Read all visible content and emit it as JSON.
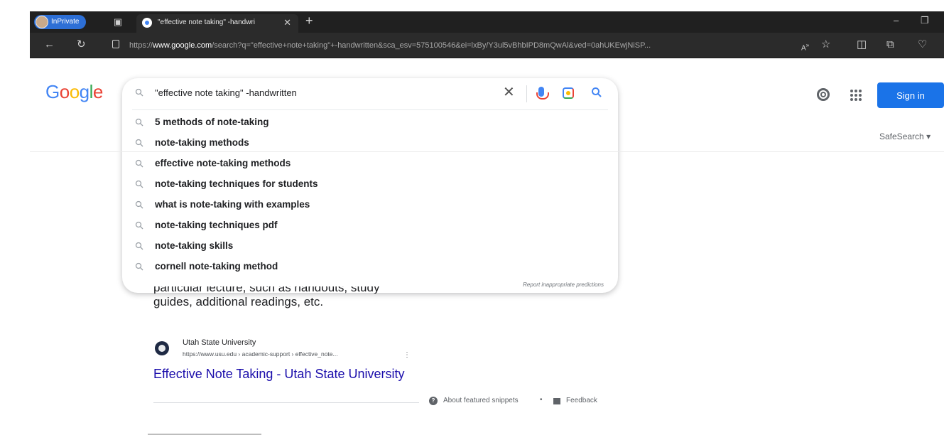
{
  "browser": {
    "inprivate_label": "InPrivate",
    "tab_title": "\"effective note taking\" -handwri",
    "url_scheme": "https://",
    "url_host": "www.google.com",
    "url_rest": "/search?q=\"effective+note+taking\"+-handwritten&sca_esv=575100546&ei=lxBy/Y3ul5vBhbIPD8mQwAl&ved=0ahUKEwjNiSP...",
    "icons": [
      "back-icon",
      "refresh-icon",
      "lock-icon",
      "read-aloud-icon",
      "favorites-icon",
      "split-screen-icon",
      "collections-icon",
      "extensions-icon"
    ]
  },
  "google": {
    "logo_letters": [
      "G",
      "o",
      "o",
      "g",
      "l",
      "e"
    ],
    "query": "\"effective note taking\" -handwritten",
    "suggestions": [
      "5 methods of note-taking",
      "note-taking methods",
      "effective note-taking methods",
      "note-taking techniques for students",
      "what is note-taking with examples",
      "note-taking techniques pdf",
      "note-taking skills",
      "cornell note-taking method"
    ],
    "report_label": "Report inappropriate predictions",
    "sign_in_label": "Sign in",
    "safesearch_label": "SafeSearch"
  },
  "result": {
    "snippet_line_partial": "particular lecture, such as handouts, study",
    "snippet_line": "guides, additional readings, etc.",
    "source_name": "Utah State University",
    "source_url": "https://www.usu.edu › academic-support › effective_note...",
    "title": "Effective Note Taking - Utah State University",
    "about_label": "About featured snippets",
    "separator": "•",
    "feedback_label": "Feedback"
  },
  "colors": {
    "accent": "#1a73e8",
    "link": "#1a0dab",
    "chrome_bg": "#202020"
  }
}
